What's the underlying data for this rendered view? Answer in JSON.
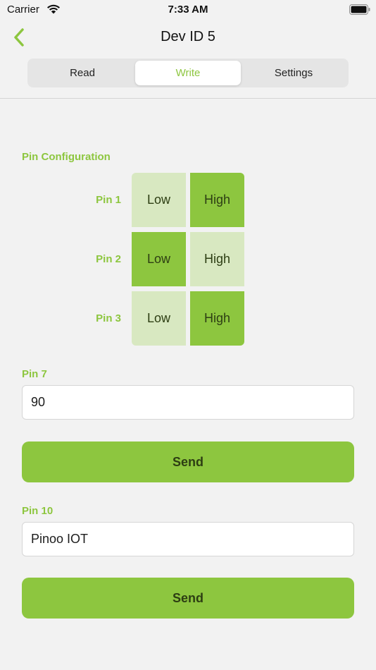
{
  "status_bar": {
    "carrier": "Carrier",
    "time": "7:33 AM"
  },
  "nav": {
    "title": "Dev ID 5",
    "back_icon": "chevron-left-icon"
  },
  "tabs": [
    {
      "label": "Read",
      "active": false
    },
    {
      "label": "Write",
      "active": true
    },
    {
      "label": "Settings",
      "active": false
    }
  ],
  "pin_configuration": {
    "title": "Pin Configuration",
    "pins": [
      {
        "label": "Pin 1",
        "low": "Low",
        "high": "High",
        "state": "high"
      },
      {
        "label": "Pin 2",
        "low": "Low",
        "high": "High",
        "state": "low"
      },
      {
        "label": "Pin 3",
        "low": "Low",
        "high": "High",
        "state": "high"
      }
    ]
  },
  "inputs": [
    {
      "label": "Pin 7",
      "value": "90",
      "button": "Send"
    },
    {
      "label": "Pin 10",
      "value": "Pinoo IOT",
      "button": "Send"
    }
  ],
  "colors": {
    "accent": "#8dc63f",
    "accent_light": "#d8e8c1",
    "background": "#f2f2f2"
  }
}
